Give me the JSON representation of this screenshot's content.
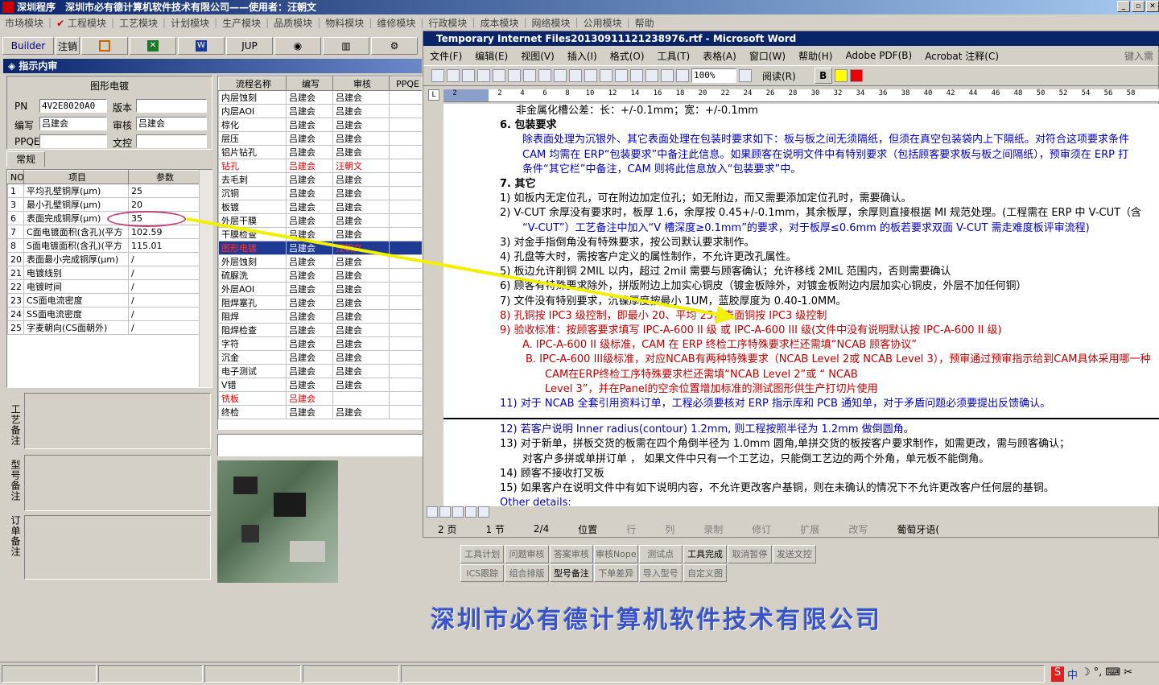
{
  "app": {
    "title": "深圳程序　深圳市必有德计算机软件技术有限公司——使用者：汪朝文",
    "win_buttons": [
      "_",
      "▫",
      "✕"
    ]
  },
  "menu": [
    "市场模块",
    "工程模块",
    "工艺模块",
    "计划模块",
    "生产模块",
    "品质模块",
    "物料模块",
    "维修模块",
    "行政模块",
    "成本模块",
    "网络模块",
    "公用模块",
    "帮助"
  ],
  "toolbar": {
    "builder": "Builder",
    "cancel": "注销",
    "jup": "JUP"
  },
  "panel": {
    "title": "指示内审",
    "group_title": "图形电镀",
    "pn_label": "PN",
    "pn_value": "4V2E8020A0",
    "version_label": "版本",
    "version_value": "",
    "writer_label": "编写",
    "writer_value": "吕建会",
    "reviewer_label": "审核",
    "reviewer_value": "吕建会",
    "ppqe_label": "PPQE",
    "ppqe_value": "",
    "text_label": "文控",
    "text_value": "",
    "tab": "常规",
    "params_headers": [
      "NO",
      "项目",
      "参数"
    ],
    "params": [
      {
        "no": "1",
        "item": "平均孔壁铜厚(μm)",
        "val": "25"
      },
      {
        "no": "3",
        "item": "最小孔壁铜厚(μm)",
        "val": "20"
      },
      {
        "no": "6",
        "item": "表面完成铜厚(μm)",
        "val": "35"
      },
      {
        "no": "7",
        "item": "C面电镀面积(含孔)(平方",
        "val": "102.59"
      },
      {
        "no": "8",
        "item": "S面电镀面积(含孔)(平方",
        "val": "115.01"
      },
      {
        "no": "20",
        "item": "表面最小完成铜厚(μm)",
        "val": "/"
      },
      {
        "no": "21",
        "item": "电镀线别",
        "val": "/"
      },
      {
        "no": "22",
        "item": "电镀时间",
        "val": "/"
      },
      {
        "no": "23",
        "item": "CS面电流密度",
        "val": "/"
      },
      {
        "no": "24",
        "item": "SS面电流密度",
        "val": "/"
      },
      {
        "no": "25",
        "item": "字麦朝向(CS面朝外)",
        "val": "/"
      }
    ],
    "notes": [
      "工艺备注",
      "型号备注",
      "订单备注"
    ]
  },
  "flow": {
    "headers": [
      "流程名称",
      "编写",
      "审核",
      "PPQE"
    ],
    "rows": [
      {
        "name": "内层蚀刻",
        "w": "吕建会",
        "r": "吕建会",
        "c": ""
      },
      {
        "name": "内层AOI",
        "w": "吕建会",
        "r": "吕建会",
        "c": ""
      },
      {
        "name": "棕化",
        "w": "吕建会",
        "r": "吕建会",
        "c": ""
      },
      {
        "name": "层压",
        "w": "吕建会",
        "r": "吕建会",
        "c": ""
      },
      {
        "name": "铝片钻孔",
        "w": "吕建会",
        "r": "吕建会",
        "c": ""
      },
      {
        "name": "钻孔",
        "w": "吕建会",
        "r": "汪朝文",
        "c": "red"
      },
      {
        "name": "去毛刺",
        "w": "吕建会",
        "r": "吕建会",
        "c": ""
      },
      {
        "name": "沉铜",
        "w": "吕建会",
        "r": "吕建会",
        "c": ""
      },
      {
        "name": "板镀",
        "w": "吕建会",
        "r": "吕建会",
        "c": ""
      },
      {
        "name": "外层干膜",
        "w": "吕建会",
        "r": "吕建会",
        "c": ""
      },
      {
        "name": "干膜检查",
        "w": "吕建会",
        "r": "吕建会",
        "c": ""
      },
      {
        "name": "图形电镀",
        "w": "吕建会",
        "r": "汪朝文",
        "c": "sel"
      },
      {
        "name": "外层蚀刻",
        "w": "吕建会",
        "r": "吕建会",
        "c": ""
      },
      {
        "name": "硫脲洗",
        "w": "吕建会",
        "r": "吕建会",
        "c": ""
      },
      {
        "name": "外层AOI",
        "w": "吕建会",
        "r": "吕建会",
        "c": ""
      },
      {
        "name": "阻焊塞孔",
        "w": "吕建会",
        "r": "吕建会",
        "c": ""
      },
      {
        "name": "阻焊",
        "w": "吕建会",
        "r": "吕建会",
        "c": ""
      },
      {
        "name": "阻焊检查",
        "w": "吕建会",
        "r": "吕建会",
        "c": ""
      },
      {
        "name": "字符",
        "w": "吕建会",
        "r": "吕建会",
        "c": ""
      },
      {
        "name": "沉金",
        "w": "吕建会",
        "r": "吕建会",
        "c": ""
      },
      {
        "name": "电子测试",
        "w": "吕建会",
        "r": "吕建会",
        "c": ""
      },
      {
        "name": "V错",
        "w": "吕建会",
        "r": "吕建会",
        "c": ""
      },
      {
        "name": "铣板",
        "w": "吕建会",
        "r": "",
        "c": "red"
      },
      {
        "name": "终检",
        "w": "吕建会",
        "r": "吕建会",
        "c": ""
      }
    ]
  },
  "word": {
    "title": "Temporary Internet Files20130911121238976.rtf - Microsoft Word",
    "menu": [
      "文件(F)",
      "编辑(E)",
      "视图(V)",
      "插入(I)",
      "格式(O)",
      "工具(T)",
      "表格(A)",
      "窗口(W)",
      "帮助(H)",
      "Adobe PDF(B)",
      "Acrobat 注释(C)",
      "键入需"
    ],
    "zoom": "100%",
    "read": "阅读(R)",
    "ruler": [
      "2",
      "",
      "2",
      "4",
      "6",
      "8",
      "10",
      "12",
      "14",
      "16",
      "18",
      "20",
      "22",
      "24",
      "26",
      "28",
      "30",
      "32",
      "34",
      "36",
      "38",
      "40",
      "42",
      "44",
      "46",
      "48",
      "50",
      "52",
      "54",
      "56",
      "58"
    ],
    "lines": [
      {
        "t": "非金属化槽公差：长：+/-0.1mm；宽：+/-0.1mm",
        "c": "",
        "i": 40
      },
      {
        "t": "6.  包装要求",
        "c": "bold",
        "i": 20
      },
      {
        "t": "除表面处理为沉银外、其它表面处理在包装时要求如下：板与板之间无须隔纸，但须在真空包装袋内上下隔纸。对符合这项要求条件",
        "c": "blue",
        "i": 48
      },
      {
        "t": "CAM 均需在 ERP“包装要求”中备注此信息。如果顾客在说明文件中有特别要求（包括顾客要求板与板之间隔纸），预审须在 ERP 打",
        "c": "blue",
        "i": 48
      },
      {
        "t": "条件“其它栏”中备注，CAM 则将此信息放入“包装要求”中。",
        "c": "blue",
        "i": 48
      },
      {
        "t": "7.  其它",
        "c": "bold",
        "i": 20
      },
      {
        "t": "1)   如板内无定位孔，可在附边加定位孔；如无附边，而又需要添加定位孔时，需要确认。",
        "c": "",
        "i": 20
      },
      {
        "t": "2)   V-CUT 余厚没有要求时，板厚 1.6，余厚按 0.45+/-0.1mm，其余板厚，余厚则直接根据 MI 规范处理。(工程需在 ERP 中 V-CUT（含",
        "c": "",
        "i": 20
      },
      {
        "t": "“V-CUT”）工艺备注中加入“V 槽深度≥0.1mm”的要求，对于板厚≤0.6mm 的板若要求双面 V-CUT 需走难度板评审流程)",
        "c": "blue",
        "i": 48
      },
      {
        "t": "3)   对金手指倒角没有特殊要求，按公司默认要求制作。",
        "c": "",
        "i": 20
      },
      {
        "t": "4)   孔盘等大时，需按客户定义的属性制作，不允许更改孔属性。",
        "c": "",
        "i": 20
      },
      {
        "t": "5)   板边允许削铜 2MIL 以内，超过 2mil 需要与顾客确认；允许移线 2MIL 范围内，否则需要确认",
        "c": "",
        "i": 20
      },
      {
        "t": "6)   顾客有特殊要求除外，拼版附边上加实心铜皮（镀金板除外，对镀金板附边内层加实心铜皮，外层不加任何铜）",
        "c": "",
        "i": 20
      },
      {
        "t": "7)   文件没有特别要求，沉镍厚度按最小 1UM，蓝胶厚度为 0.40-1.0MM。",
        "c": "",
        "i": 20
      },
      {
        "t": "8)   孔铜按 IPC3 级控制，即最小 20、平均 25，表面铜按 IPC3 级控制",
        "c": "dkred",
        "i": 20
      },
      {
        "t": "9)   验收标准：按顾客要求填写 IPC-A-600 II 级 或 IPC-A-600 III 级(文件中没有说明默认按 IPC-A-600 II 级)",
        "c": "dkred",
        "i": 20
      },
      {
        "t": "A.  IPC-A-600 II 级标准，CAM 在 ERP 终检工序特殊要求栏还需填“NCAB 顾客协议”",
        "c": "dkred",
        "i": 48
      },
      {
        "t": "B.  IPC-A-600 III级标准，对应NCAB有两种特殊要求（NCAB Level 2或 NCAB Level 3），预审通过预审指示给到CAM具体采用哪一种",
        "c": "dkred",
        "i": 52
      },
      {
        "t": "CAM在ERP终检工序特殊要求栏还需填“NCAB Level 2”或 “ NCAB",
        "c": "dkred",
        "i": 76
      },
      {
        "t": "Level 3”，并在Panel的空余位置增加标准的测试图形供生产打切片使用",
        "c": "dkred",
        "i": 76
      },
      {
        "t": "11) 对于 NCAB 全套引用资料订单，工程必须要核对 ERP 指示库和 PCB 通知单，对于矛盾问题必须要提出反馈确认。",
        "c": "blue",
        "i": 20
      },
      {
        "t": "",
        "c": "",
        "i": 20
      },
      {
        "t": "12) 若客户说明 Inner radius(contour) 1.2mm,   则工程按照半径为 1.2mm 做倒圆角。",
        "c": "blue",
        "i": 20
      },
      {
        "t": "13) 对于新单，拼板交货的板需在四个角倒半径为 1.0mm 圆角,单拼交货的板按客户要求制作，如需更改，需与顾客确认；",
        "c": "",
        "i": 20
      },
      {
        "t": "对客户多拼或单拼订单 ， 如果文件中只有一个工艺边，只能倒工艺边的两个外角，单元板不能倒角。",
        "c": "",
        "i": 48
      },
      {
        "t": "14) 顾客不接收打叉板",
        "c": "",
        "i": 20
      },
      {
        "t": "15) 如果客户在说明文件中有如下说明内容，不允许更改客户基铜，则在未确认的情况下不允许更改客户任何层的基铜。",
        "c": "",
        "i": 20
      },
      {
        "t": "Other details:",
        "c": "blue",
        "i": 20
      }
    ],
    "status": [
      "2 页",
      "1 节",
      "2/4",
      "位置",
      "行",
      "列",
      "录制",
      "修订",
      "扩展",
      "改写",
      "葡萄牙语("
    ]
  },
  "bottom_buttons": [
    "工具计划",
    "问题审核",
    "答案审核",
    "审核Nope",
    "测试点",
    "工具完成",
    "取消暂停",
    "发送文控",
    "ICS跟踪",
    "组合排版",
    "型号备注",
    "下单差异",
    "导入型号",
    "自定义图"
  ],
  "company": "深圳市必有德计算机软件技术有限公司",
  "tray": [
    "S",
    "中",
    "☽",
    "°,",
    "⌨",
    "✂"
  ]
}
